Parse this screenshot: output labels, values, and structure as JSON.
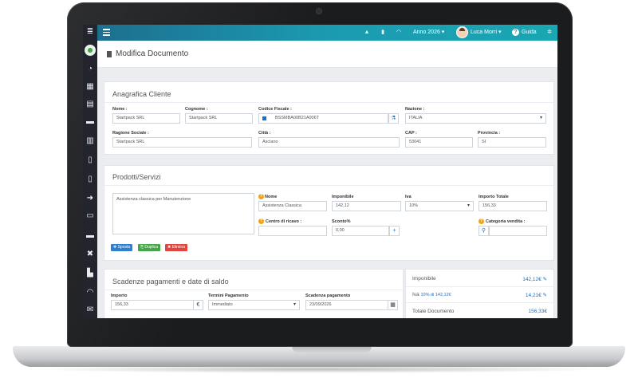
{
  "topbar": {
    "year_label": "Anno 2026 ▾",
    "user_name": "Luca Morri ▾",
    "help_label": "Guida"
  },
  "page": {
    "title": "Modifica Documento"
  },
  "cliente": {
    "section_title": "Anagrafica Cliente",
    "nome_label": "Nome :",
    "nome_value": "Startpack SRL",
    "cognome_label": "Cognome :",
    "cognome_value": "Startpack SRL",
    "cf_label": "Codice Fiscale :",
    "cf_value": "BSSMBA00B21A006T",
    "nazione_label": "Nazione :",
    "nazione_value": "ITALIA",
    "ragione_label": "Ragione Sociale :",
    "ragione_value": "Startpack SRL",
    "citta_label": "Città :",
    "citta_value": "Asciano",
    "cap_label": "CAP :",
    "cap_value": "53041",
    "provincia_label": "Provincia :",
    "provincia_value": "SI"
  },
  "prodotti": {
    "section_title": "Prodotti/Servizi",
    "description": "Assistenza classica per Manutenzione",
    "nome_label": "Nome",
    "nome_value": "Assistenza Classica",
    "imponibile_label": "Imponibile",
    "imponibile_value": "142,12",
    "iva_label": "Iva",
    "iva_value": "10%",
    "importo_label": "Importo Totale",
    "importo_value": "156,33",
    "centro_label": "Centro di ricavo :",
    "sconto_label": "Sconto%",
    "sconto_value": "0,00",
    "categoria_label": "Categoria vendita :",
    "btn_sposta": "✥ Sposta",
    "btn_duplica": "⎘ Duplica",
    "btn_elimina": "✖ Elimina"
  },
  "scadenze": {
    "section_title": "Scadenze pagamenti e date di saldo",
    "importo_label": "Importo",
    "importo_value": "156,33",
    "currency": "€",
    "termini_label": "Termini Pagamento",
    "termini_value": "Immediato",
    "scadenza_label": "Scadenza pagamento",
    "scadenza_value": "23/09/2026"
  },
  "riepilogo": {
    "imponibile_label": "Imponibile",
    "imponibile_value": "142,12€",
    "iva_label": "Iva",
    "iva_detail": "10% di 142,12€",
    "iva_value": "14,21€",
    "totale_label": "Totale Documento",
    "totale_value": "156,33€"
  },
  "colors": {
    "topbar_start": "#1c6f8f",
    "topbar_end": "#1aa6b3",
    "sidebar": "#22252d",
    "link_blue": "#1b6ec2",
    "btn_sposta": "#2f7fd0",
    "btn_duplica": "#45a649",
    "btn_elimina": "#e0453f",
    "warning_orange": "#f0a21b"
  },
  "icons": {
    "sidebar": [
      "menu-icon",
      "logo-icon",
      "dashboard-icon",
      "calendar-icon",
      "clipboard-icon",
      "briefcase-icon",
      "document-icon",
      "file-icon",
      "file-icon",
      "login-icon",
      "ticket-icon",
      "box-icon",
      "tools-icon",
      "chart-icon",
      "headset-icon",
      "mail-icon"
    ],
    "topbar": [
      "bell-icon",
      "book-icon",
      "headset-icon",
      "gears-icon"
    ]
  }
}
